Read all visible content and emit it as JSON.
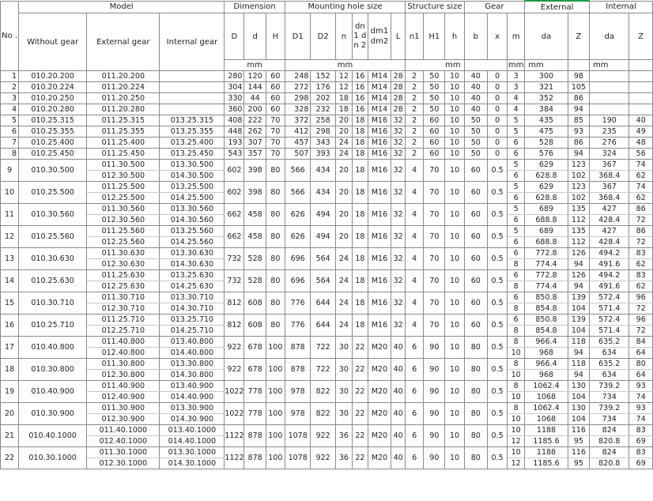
{
  "header": {
    "no": "No .",
    "model": "Model",
    "without_gear": "Without gear",
    "external_gear": "External gear",
    "internal_gear": "Internal gear",
    "dimension": "Dimension",
    "mounting": "Mounting hole size",
    "structure": "Structure size",
    "gear": "Gear",
    "external": "External",
    "internal": "Internal",
    "cols": {
      "D": "D",
      "d": "d",
      "H": "H",
      "D1": "D1",
      "D2": "D2",
      "n": "n",
      "dn": "dn 1 dn 2",
      "dm": "dm1 dm2",
      "L": "L",
      "n1": "n1",
      "H1": "H1",
      "h": "h",
      "b": "b",
      "x": "x",
      "m": "m",
      "da_ext": "da",
      "Z_ext": "Z",
      "da_int": "da",
      "Z_int": "Z"
    },
    "units": {
      "dim": "mm",
      "mount": "mm",
      "struct": "mm",
      "m": "mm",
      "ext": "mm",
      "int": "mm"
    }
  },
  "simple_rows": [
    {
      "no": "1",
      "wg": "010.20.200",
      "eg": "011.20.200",
      "ig": "",
      "D": "280",
      "d": "120",
      "H": "60",
      "D1": "248",
      "D2": "152",
      "n": "12",
      "dn": "16",
      "dm": "M14",
      "L": "28",
      "n1": "2",
      "H1": "50",
      "h": "10",
      "b": "40",
      "x": "0",
      "m": "3",
      "da": "300",
      "Z": "98",
      "dai": "",
      "Zi": ""
    },
    {
      "no": "2",
      "wg": "010.20.224",
      "eg": "011.20.224",
      "ig": "",
      "D": "304",
      "d": "144",
      "H": "60",
      "D1": "272",
      "D2": "176",
      "n": "12",
      "dn": "16",
      "dm": "M14",
      "L": "28",
      "n1": "2",
      "H1": "50",
      "h": "10",
      "b": "40",
      "x": "0",
      "m": "3",
      "da": "321",
      "Z": "105",
      "dai": "",
      "Zi": ""
    },
    {
      "no": "3",
      "wg": "010.20.250",
      "eg": "011.20.250",
      "ig": "",
      "D": "330",
      "d": "44",
      "H": "60",
      "D1": "298",
      "D2": "202",
      "n": "18",
      "dn": "16",
      "dm": "M14",
      "L": "28",
      "n1": "2",
      "H1": "50",
      "h": "10",
      "b": "40",
      "x": "0",
      "m": "4",
      "da": "352",
      "Z": "86",
      "dai": "",
      "Zi": ""
    },
    {
      "no": "4",
      "wg": "010.20.280",
      "eg": "011.20.280",
      "ig": "",
      "D": "360",
      "d": "200",
      "H": "60",
      "D1": "328",
      "D2": "232",
      "n": "18",
      "dn": "16",
      "dm": "M14",
      "L": "28",
      "n1": "2",
      "H1": "50",
      "h": "10",
      "b": "40",
      "x": "0",
      "m": "4",
      "da": "384",
      "Z": "94",
      "dai": "",
      "Zi": ""
    },
    {
      "no": "5",
      "wg": "010.25.315",
      "eg": "011.25.315",
      "ig": "013.25.315",
      "D": "408",
      "d": "222",
      "H": "70",
      "D1": "372",
      "D2": "258",
      "n": "20",
      "dn": "18",
      "dm": "M16",
      "L": "32",
      "n1": "2",
      "H1": "60",
      "h": "10",
      "b": "50",
      "x": "0",
      "m": "5",
      "da": "435",
      "Z": "85",
      "dai": "190",
      "Zi": "40"
    },
    {
      "no": "6",
      "wg": "010.25.355",
      "eg": "011.25.355",
      "ig": "013.25.355",
      "D": "448",
      "d": "262",
      "H": "70",
      "D1": "412",
      "D2": "298",
      "n": "20",
      "dn": "18",
      "dm": "M16",
      "L": "32",
      "n1": "2",
      "H1": "60",
      "h": "10",
      "b": "50",
      "x": "0",
      "m": "5",
      "da": "475",
      "Z": "93",
      "dai": "235",
      "Zi": "49"
    },
    {
      "no": "7",
      "wg": "010.25.400",
      "eg": "011.25.400",
      "ig": "013.25.400",
      "D": "193",
      "d": "307",
      "H": "70",
      "D1": "457",
      "D2": "343",
      "n": "24",
      "dn": "18",
      "dm": "M16",
      "L": "32",
      "n1": "2",
      "H1": "60",
      "h": "10",
      "b": "50",
      "x": "0",
      "m": "6",
      "da": "528",
      "Z": "86",
      "dai": "276",
      "Zi": "48"
    },
    {
      "no": "8",
      "wg": "010.25.450",
      "eg": "011.25.450",
      "ig": "013.25.450",
      "D": "543",
      "d": "357",
      "H": "70",
      "D1": "507",
      "D2": "393",
      "n": "24",
      "dn": "18",
      "dm": "M16",
      "L": "32",
      "n1": "2",
      "H1": "60",
      "h": "10",
      "b": "50",
      "x": "0",
      "m": "6",
      "da": "576",
      "Z": "94",
      "dai": "324",
      "Zi": "56"
    }
  ],
  "double_rows": [
    {
      "no": "9",
      "wg": "010.30.500",
      "eg": [
        "011.30.500",
        "012.30.500"
      ],
      "ig": [
        "013.30.500",
        "014.30.500"
      ],
      "D": "602",
      "d": "398",
      "H": "80",
      "D1": "566",
      "D2": "434",
      "n": "20",
      "dn": "18",
      "dm": "M16",
      "L": "32",
      "n1": "4",
      "H1": "70",
      "h": "10",
      "b": "60",
      "x": "0.5",
      "m": [
        "5",
        "6"
      ],
      "da": [
        "629",
        "628.8"
      ],
      "Z": [
        "123",
        "102"
      ],
      "dai": [
        "367",
        "368.4"
      ],
      "Zi": [
        "74",
        "62"
      ]
    },
    {
      "no": "10",
      "wg": "010.25.500",
      "eg": [
        "011.25.500",
        "012.25.500"
      ],
      "ig": [
        "013.25.500",
        "014.25.500"
      ],
      "D": "602",
      "d": "398",
      "H": "80",
      "D1": "566",
      "D2": "434",
      "n": "20",
      "dn": "18",
      "dm": "M16",
      "L": "32",
      "n1": "4",
      "H1": "70",
      "h": "10",
      "b": "60",
      "x": "0.5",
      "m": [
        "5",
        "6"
      ],
      "da": [
        "629",
        "628.8"
      ],
      "Z": [
        "123",
        "102"
      ],
      "dai": [
        "367",
        "368.4"
      ],
      "Zi": [
        "74",
        "62"
      ]
    },
    {
      "no": "11",
      "wg": "010.30.560",
      "eg": [
        "011.30.560",
        "012.30.560"
      ],
      "ig": [
        "013.30.560",
        "014.30.560"
      ],
      "D": "662",
      "d": "458",
      "H": "80",
      "D1": "626",
      "D2": "494",
      "n": "20",
      "dn": "18",
      "dm": "M16",
      "L": "32",
      "n1": "4",
      "H1": "70",
      "h": "10",
      "b": "60",
      "x": "0.5",
      "m": [
        "5",
        "6"
      ],
      "da": [
        "689",
        "688.8"
      ],
      "Z": [
        "135",
        "112"
      ],
      "dai": [
        "427",
        "428.4"
      ],
      "Zi": [
        "86",
        "72"
      ]
    },
    {
      "no": "12",
      "wg": "010.25.560",
      "eg": [
        "011.25.560",
        "012.25.560"
      ],
      "ig": [
        "013.25.560",
        "014.25.560"
      ],
      "D": "662",
      "d": "458",
      "H": "80",
      "D1": "626",
      "D2": "494",
      "n": "20",
      "dn": "18",
      "dm": "M16",
      "L": "32",
      "n1": "4",
      "H1": "70",
      "h": "10",
      "b": "60",
      "x": "0.5",
      "m": [
        "5",
        "6"
      ],
      "da": [
        "689",
        "688.8"
      ],
      "Z": [
        "135",
        "112"
      ],
      "dai": [
        "427",
        "428.4"
      ],
      "Zi": [
        "86",
        "72"
      ]
    },
    {
      "no": "13",
      "wg": "010.30.630",
      "eg": [
        "011.30.630",
        "012.30.630"
      ],
      "ig": [
        "013.30.630",
        "014.30.630"
      ],
      "D": "732",
      "d": "528",
      "H": "80",
      "D1": "696",
      "D2": "564",
      "n": "24",
      "dn": "18",
      "dm": "M16",
      "L": "32",
      "n1": "4",
      "H1": "70",
      "h": "10",
      "b": "60",
      "x": "0.5",
      "m": [
        "6",
        "8"
      ],
      "da": [
        "772.8",
        "774.4"
      ],
      "Z": [
        "126",
        "94"
      ],
      "dai": [
        "494.2",
        "491.6"
      ],
      "Zi": [
        "83",
        "62"
      ]
    },
    {
      "no": "14",
      "wg": "010.25.630",
      "eg": [
        "011.25.630",
        "012.25.630"
      ],
      "ig": [
        "013.25.630",
        "014.25.630"
      ],
      "D": "732",
      "d": "528",
      "H": "80",
      "D1": "696",
      "D2": "564",
      "n": "24",
      "dn": "18",
      "dm": "M16",
      "L": "32",
      "n1": "4",
      "H1": "70",
      "h": "10",
      "b": "60",
      "x": "0.5",
      "m": [
        "6",
        "8"
      ],
      "da": [
        "772.8",
        "774.4"
      ],
      "Z": [
        "126",
        "94"
      ],
      "dai": [
        "494.2",
        "491.6"
      ],
      "Zi": [
        "83",
        "62"
      ]
    },
    {
      "no": "15",
      "wg": "010.30.710",
      "eg": [
        "011.30.710",
        "012.30.710"
      ],
      "ig": [
        "013.30.710",
        "014.30.710"
      ],
      "D": "812",
      "d": "608",
      "H": "80",
      "D1": "776",
      "D2": "644",
      "n": "24",
      "dn": "18",
      "dm": "M16",
      "L": "32",
      "n1": "4",
      "H1": "70",
      "h": "10",
      "b": "60",
      "x": "0.5",
      "m": [
        "6",
        "8"
      ],
      "da": [
        "850.8",
        "854.8"
      ],
      "Z": [
        "139",
        "104"
      ],
      "dai": [
        "572.4",
        "571.4"
      ],
      "Zi": [
        "96",
        "72"
      ]
    },
    {
      "no": "16",
      "wg": "010.25.710",
      "eg": [
        "011.25.710",
        "012.25.710"
      ],
      "ig": [
        "013.25.710",
        "014.25.710"
      ],
      "D": "812",
      "d": "608",
      "H": "80",
      "D1": "776",
      "D2": "644",
      "n": "24",
      "dn": "18",
      "dm": "M16",
      "L": "32",
      "n1": "4",
      "H1": "70",
      "h": "10",
      "b": "60",
      "x": "0.5",
      "m": [
        "6",
        "8"
      ],
      "da": [
        "850.8",
        "854.8"
      ],
      "Z": [
        "139",
        "104"
      ],
      "dai": [
        "572.4",
        "571.4"
      ],
      "Zi": [
        "96",
        "72"
      ]
    },
    {
      "no": "17",
      "wg": "010.40.800",
      "eg": [
        "011.40.800",
        "012.40.800"
      ],
      "ig": [
        "013.40.800",
        "014.40.800"
      ],
      "D": "922",
      "d": "678",
      "H": "100",
      "D1": "878",
      "D2": "722",
      "n": "30",
      "dn": "22",
      "dm": "M20",
      "L": "40",
      "n1": "6",
      "H1": "90",
      "h": "10",
      "b": "80",
      "x": "0.5",
      "m": [
        "8",
        "10"
      ],
      "da": [
        "966.4",
        "968"
      ],
      "Z": [
        "118",
        "94"
      ],
      "dai": [
        "635.2",
        "634"
      ],
      "Zi": [
        "84",
        "64"
      ]
    },
    {
      "no": "18",
      "wg": "010.30.800",
      "eg": [
        "011.30.800",
        "012.30.800"
      ],
      "ig": [
        "013.30.800",
        "014.30.800"
      ],
      "D": "922",
      "d": "678",
      "H": "100",
      "D1": "878",
      "D2": "722",
      "n": "30",
      "dn": "22",
      "dm": "M20",
      "L": "40",
      "n1": "6",
      "H1": "90",
      "h": "10",
      "b": "80",
      "x": "0.5",
      "m": [
        "8",
        "10"
      ],
      "da": [
        "966.4",
        "968"
      ],
      "Z": [
        "118",
        "94"
      ],
      "dai": [
        "635.2",
        "634"
      ],
      "Zi": [
        "80",
        "64"
      ]
    },
    {
      "no": "19",
      "wg": "010.40.900",
      "eg": [
        "011.40.900",
        "012.40.900"
      ],
      "ig": [
        "013.40.900",
        "014.40.900"
      ],
      "D": "1022",
      "d": "778",
      "H": "100",
      "D1": "978",
      "D2": "822",
      "n": "30",
      "dn": "22",
      "dm": "M20",
      "L": "40",
      "n1": "6",
      "H1": "90",
      "h": "10",
      "b": "80",
      "x": "0.5",
      "m": [
        "8",
        "10"
      ],
      "da": [
        "1062.4",
        "1068"
      ],
      "Z": [
        "130",
        "104"
      ],
      "dai": [
        "739.2",
        "734"
      ],
      "Zi": [
        "93",
        "74"
      ]
    },
    {
      "no": "20",
      "wg": "010.30.900",
      "eg": [
        "011.30.900",
        "012.30.900"
      ],
      "ig": [
        "013.30.900",
        "014.30.900"
      ],
      "D": "1022",
      "d": "778",
      "H": "100",
      "D1": "978",
      "D2": "822",
      "n": "30",
      "dn": "22",
      "dm": "M20",
      "L": "40",
      "n1": "6",
      "H1": "90",
      "h": "10",
      "b": "80",
      "x": "0.5",
      "m": [
        "8",
        "10"
      ],
      "da": [
        "1062.4",
        "1068"
      ],
      "Z": [
        "130",
        "104"
      ],
      "dai": [
        "739.2",
        "734"
      ],
      "Zi": [
        "93",
        "74"
      ]
    },
    {
      "no": "21",
      "wg": "010.40.1000",
      "eg": [
        "011.40.1000",
        "012.40.1000"
      ],
      "ig": [
        "013.40.1000",
        "014.40.1000"
      ],
      "D": "1122",
      "d": "878",
      "H": "100",
      "D1": "1078",
      "D2": "922",
      "n": "36",
      "dn": "22",
      "dm": "M20",
      "L": "40",
      "n1": "6",
      "H1": "90",
      "h": "10",
      "b": "80",
      "x": "0.5",
      "m": [
        "10",
        "12"
      ],
      "da": [
        "1188",
        "1185.6"
      ],
      "Z": [
        "116",
        "95"
      ],
      "dai": [
        "824",
        "820.8"
      ],
      "Zi": [
        "83",
        "69"
      ]
    },
    {
      "no": "22",
      "wg": "010.30.1000",
      "eg": [
        "011.30.1000",
        "012.30.1000"
      ],
      "ig": [
        "013.30.1000",
        "014.30.1000"
      ],
      "D": "1122",
      "d": "878",
      "H": "100",
      "D1": "1078",
      "D2": "922",
      "n": "36",
      "dn": "22",
      "dm": "M20",
      "L": "40",
      "n1": "6",
      "H1": "90",
      "h": "10",
      "b": "80",
      "x": "0.5",
      "m": [
        "10",
        "12"
      ],
      "da": [
        "1188",
        "1185.6"
      ],
      "Z": [
        "116",
        "95"
      ],
      "dai": [
        "824",
        "820.8"
      ],
      "Zi": [
        "83",
        "69"
      ]
    }
  ]
}
